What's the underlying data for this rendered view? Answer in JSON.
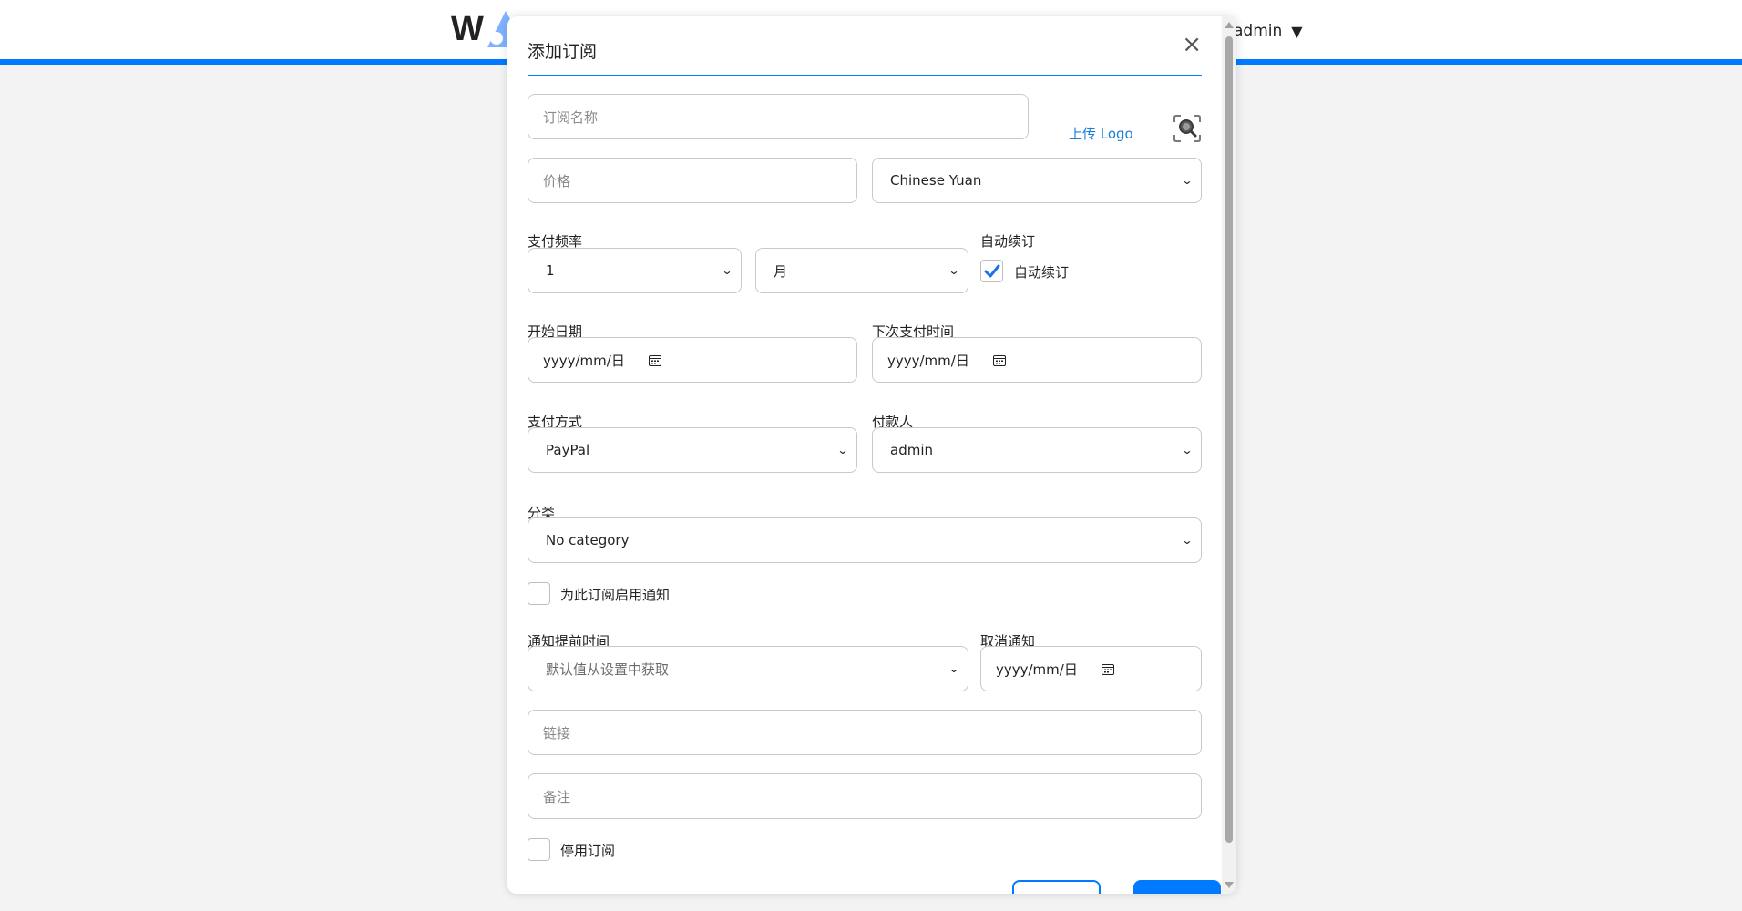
{
  "header": {
    "logo_letter": "W",
    "user_name": "admin",
    "user_caret": "▼"
  },
  "modal": {
    "title": "添加订阅",
    "close_symbol": "×",
    "name_placeholder": "订阅名称",
    "upload_logo": "上传 Logo",
    "price_placeholder": "价格",
    "currency": "Chinese Yuan",
    "frequency_label": "支付频率",
    "frequency_value": "1",
    "frequency_unit": "月",
    "auto_renew_label": "自动续订",
    "auto_renew_checkbox_label": "自动续订",
    "auto_renew_checked": true,
    "start_date_label": "开始日期",
    "start_date_value": "yyyy/mm/日",
    "next_payment_label": "下次支付时间",
    "next_payment_value": "yyyy/mm/日",
    "payment_method_label": "支付方式",
    "payment_method": "PayPal",
    "payer_label": "付款人",
    "payer": "admin",
    "category_label": "分类",
    "category": "No category",
    "enable_notify_label": "为此订阅启用通知",
    "notify_before_label": "通知提前时间",
    "notify_before_value": "默认值从设置中获取",
    "cancel_notify_label": "取消通知",
    "cancel_notify_value": "yyyy/mm/日",
    "url_placeholder": "链接",
    "notes_placeholder": "备注",
    "disable_label": "停用订阅"
  },
  "colors": {
    "accent": "#007bff",
    "link": "#1a7fd8",
    "background": "#f3f3f3"
  },
  "icons": [
    "close-icon",
    "search-icon",
    "calendar-icon",
    "chevron-down-icon",
    "check-icon"
  ]
}
